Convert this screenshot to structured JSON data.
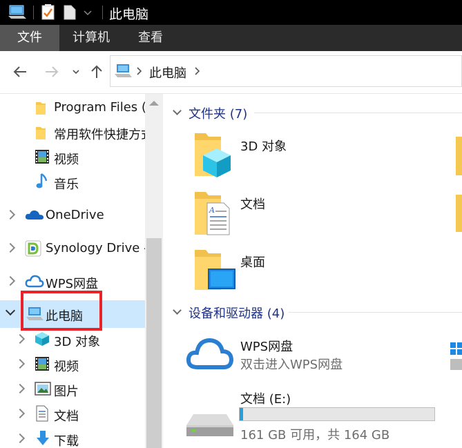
{
  "window": {
    "title": "此电脑"
  },
  "ribbon": {
    "tabs": [
      {
        "label": "文件",
        "active": true
      },
      {
        "label": "计算机",
        "active": false
      },
      {
        "label": "查看",
        "active": false
      }
    ]
  },
  "address": {
    "path": "此电脑"
  },
  "tree": {
    "items": [
      {
        "label": "Program Files (:",
        "icon": "folder-icon"
      },
      {
        "label": "常用软件快捷方式",
        "icon": "folder-icon"
      },
      {
        "label": "视频",
        "icon": "video-icon"
      },
      {
        "label": "音乐",
        "icon": "music-icon"
      },
      {
        "label": "OneDrive",
        "icon": "cloud-icon"
      },
      {
        "label": "Synology Drive -",
        "icon": "synology-icon"
      },
      {
        "label": "WPS网盘",
        "icon": "wps-cloud-icon"
      },
      {
        "label": "此电脑",
        "icon": "computer-icon"
      },
      {
        "label": "3D 对象",
        "icon": "3d-cube-icon"
      },
      {
        "label": "视频",
        "icon": "video-icon"
      },
      {
        "label": "图片",
        "icon": "picture-icon"
      },
      {
        "label": "文档",
        "icon": "document-icon"
      },
      {
        "label": "下载",
        "icon": "download-icon"
      }
    ]
  },
  "content": {
    "folders_header": "文件夹 (7)",
    "folders": [
      {
        "name": "3D 对象"
      },
      {
        "name": "文档"
      },
      {
        "name": "桌面"
      }
    ],
    "drives_header": "设备和驱动器 (4)",
    "drives": [
      {
        "name": "WPS网盘",
        "sub": "双击进入WPS网盘"
      },
      {
        "name": "文档 (E:)",
        "sub": "161 GB 可用，共 164 GB",
        "used_fraction": 0.018
      }
    ]
  },
  "colors": {
    "accent": "#26a0da",
    "selected": "#cce8ff",
    "highlight": "#e8242a",
    "group_header": "#1e3287"
  }
}
